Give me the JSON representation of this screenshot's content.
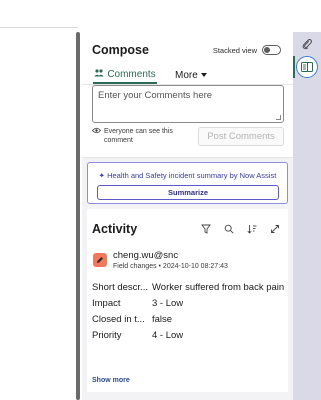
{
  "compose": {
    "title": "Compose",
    "stacked_view_label": "Stacked view",
    "tabs": {
      "comments": "Comments",
      "more": "More"
    },
    "comment_placeholder": "Enter your Comments here",
    "visibility_note": "Everyone can see this comment",
    "post_button": "Post Comments"
  },
  "now_assist": {
    "title": "Health and Safety incident summary by Now Assist",
    "button": "Summarize"
  },
  "activity": {
    "title": "Activity",
    "entry": {
      "user": "cheng.wu@snc",
      "meta": "Field changes • 2024-10-10 08:27:43",
      "fields": [
        {
          "label": "Short descr...",
          "value": "Worker suffered from back pain"
        },
        {
          "label": "Impact",
          "value": "3 - Low"
        },
        {
          "label": "Closed in t...",
          "value": "false"
        },
        {
          "label": "Priority",
          "value": "4 - Low"
        }
      ]
    },
    "show_more": "Show more"
  },
  "icons": {
    "tab_comments": "people-icon",
    "visibility": "eye-icon",
    "ai": "sparkle-icon",
    "filter": "filter-icon",
    "search": "search-icon",
    "sort": "sort-icon",
    "expand": "expand-icon",
    "avatar": "pencil-icon",
    "attachment": "paperclip-icon",
    "panel": "compose-panel-icon"
  },
  "colors": {
    "accent": "#2d6b55",
    "now_assist": "#5b59c9",
    "avatar": "#f0795f",
    "rail": "#d9d9e8"
  }
}
